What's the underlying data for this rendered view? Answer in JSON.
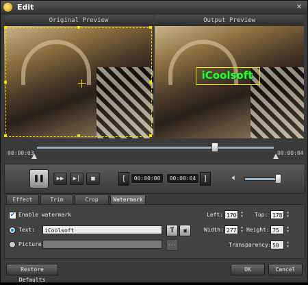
{
  "window": {
    "title": "Edit"
  },
  "preview": {
    "original_label": "Original Preview",
    "output_label": "Output Preview"
  },
  "watermark_preview_text": "iCoolsoft",
  "timeline": {
    "start_time": "00:00:03",
    "end_time": "00:00:04",
    "playhead_fraction": 0.75
  },
  "controls": {
    "start_point": "00:00:00",
    "end_point": "00:00:04",
    "volume_fraction": 0.95
  },
  "tabs": [
    "Effect",
    "Trim",
    "Crop",
    "Watermark"
  ],
  "active_tab": "Watermark",
  "watermark": {
    "enable_label": "Enable watermark",
    "enabled": true,
    "text_label": "Text:",
    "text_value": "iCoolsoft",
    "picture_label": "Picture:",
    "left_label": "Left:",
    "left_value": "170",
    "top_label": "Top:",
    "top_value": "178",
    "width_label": "Width:",
    "width_value": "277",
    "height_label": "Height:",
    "height_value": "75",
    "transparency_label": "Transparency:",
    "transparency_value": "50"
  },
  "buttons": {
    "restore": "Restore Defaults",
    "ok": "OK",
    "cancel": "Cancel"
  },
  "colors": {
    "crop_frame": "#e6e600",
    "watermark_text": "#2bff2b"
  }
}
